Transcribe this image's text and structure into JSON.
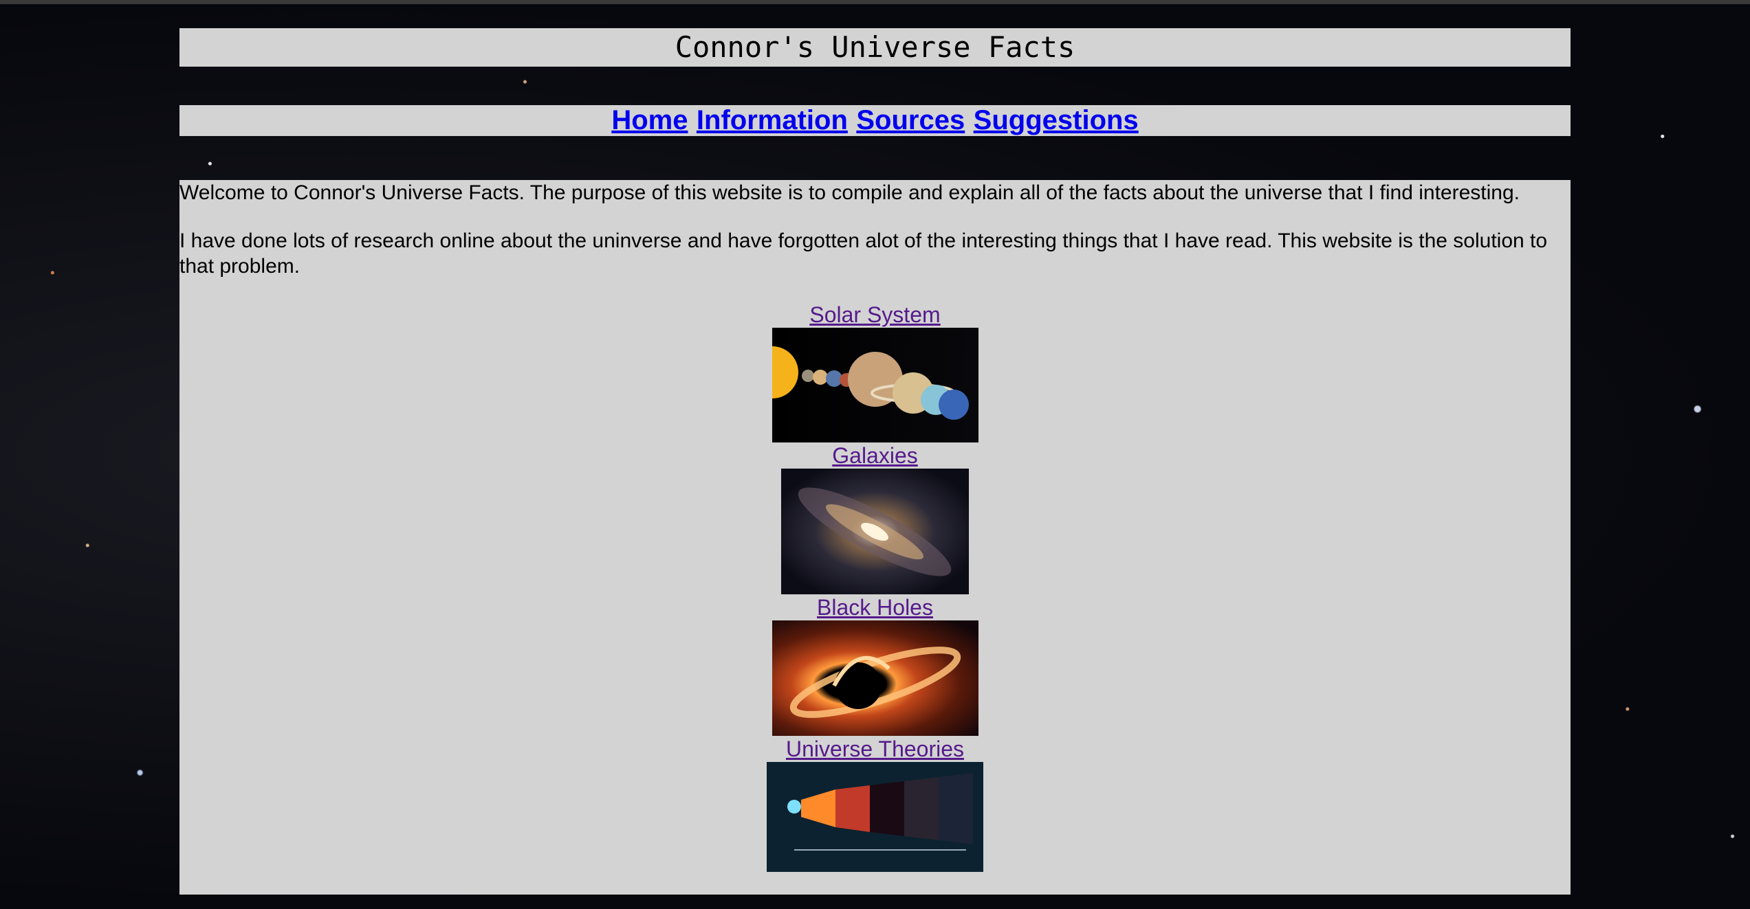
{
  "header": {
    "title": "Connor's Universe Facts"
  },
  "nav": {
    "links": [
      {
        "label": "Home"
      },
      {
        "label": "Information"
      },
      {
        "label": "Sources"
      },
      {
        "label": "Suggestions"
      }
    ]
  },
  "main": {
    "paragraphs": [
      "Welcome to Connor's Universe Facts. The purpose of this website is to compile and explain all of the facts about the universe that I find interesting.",
      "I have done lots of research online about the uninverse and have forgotten alot of the interesting things that I have read. This website is the solution to that problem."
    ],
    "topics": [
      {
        "label": "Solar System",
        "image": "solar-system-image"
      },
      {
        "label": "Galaxies",
        "image": "galaxy-image"
      },
      {
        "label": "Black Holes",
        "image": "black-hole-image"
      },
      {
        "label": "Universe Theories",
        "image": "universe-timeline-image"
      }
    ]
  },
  "colors": {
    "panel": "#d3d3d3",
    "link_unvisited": "#0000ee",
    "link_visited": "#551a8b"
  }
}
